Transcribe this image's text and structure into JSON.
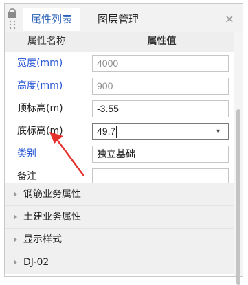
{
  "tabs": [
    {
      "label": "属性列表",
      "active": true
    },
    {
      "label": "图层管理",
      "active": false
    }
  ],
  "close_glyph": "×",
  "table": {
    "header_name": "属性名称",
    "header_value": "属性值"
  },
  "properties": [
    {
      "name": "宽度(mm)",
      "value": "4000"
    },
    {
      "name": "高度(mm)",
      "value": "900"
    },
    {
      "name": "顶标高(m)",
      "value": "-3.55"
    },
    {
      "name": "底标高(m)",
      "value": "49.7"
    },
    {
      "name": "类别",
      "value": "独立基础"
    },
    {
      "name": "备注",
      "value": ""
    }
  ],
  "groups": [
    "钢筋业务属性",
    "土建业务属性",
    "显示样式",
    "DJ-02"
  ],
  "colors": {
    "accent": "#2b63b8",
    "label_blue": "#2857d6",
    "arrow": "#e5322d"
  },
  "icons": [
    "lock-icon",
    "dropdown-caret-icon",
    "expand-triangle-icon",
    "annotation-arrow"
  ]
}
